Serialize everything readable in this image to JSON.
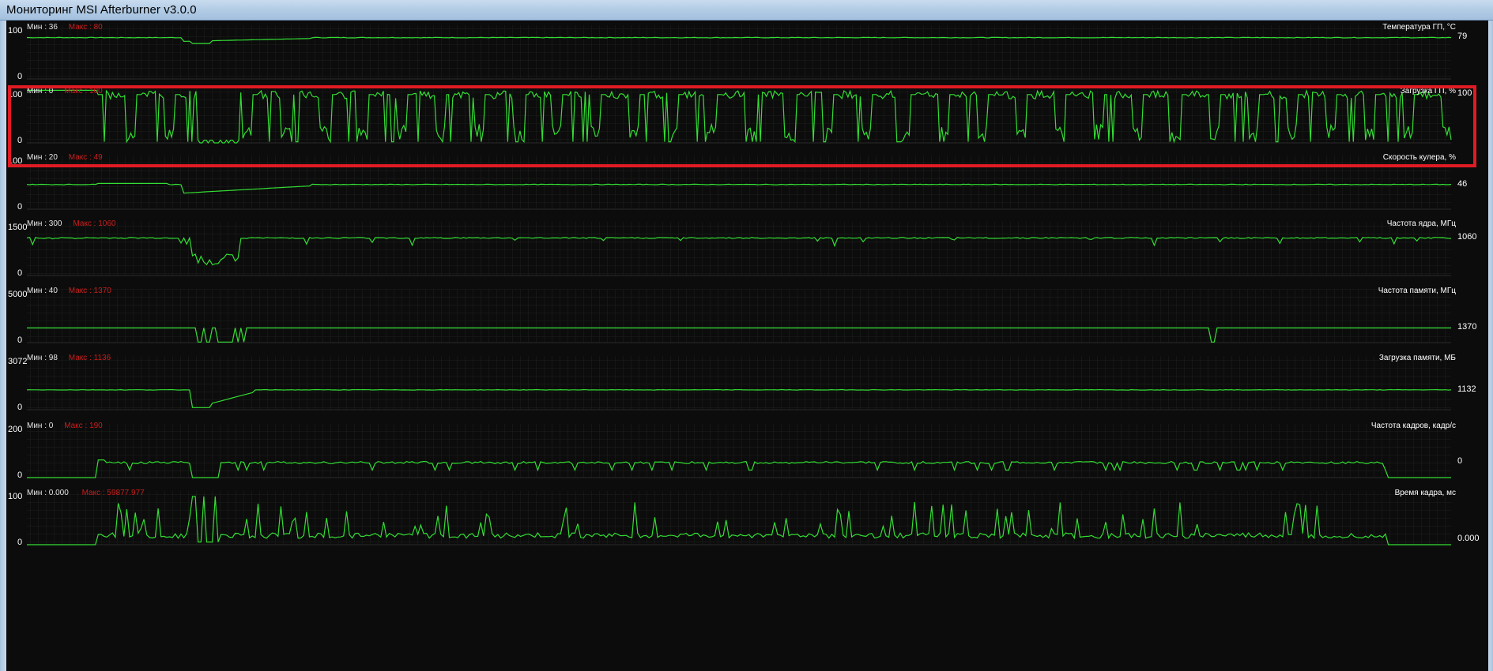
{
  "window": {
    "title": "Мониторинг MSI Afterburner v3.0.0"
  },
  "colors": {
    "graph_line": "#33dd33",
    "min_text": "#e6e6e6",
    "max_text": "#c81e1e",
    "highlight": "#e01b24"
  },
  "panels": [
    {
      "id": "gpu-temp",
      "name": "Температура ГП, °C",
      "min_label": "Мин : 36",
      "max_label": "Макс : 80",
      "axis_top": "100",
      "axis_bottom": "0",
      "current": "79",
      "level": 0.78,
      "pattern": "temp"
    },
    {
      "id": "gpu-load",
      "name": "Загрузка ГП, %",
      "min_label": "Мин : 0",
      "max_label": "Макс : 100",
      "axis_top": "100",
      "axis_bottom": "0",
      "current": "100",
      "level": 1.0,
      "pattern": "load"
    },
    {
      "id": "fan-speed",
      "name": "Скорость кулера, %",
      "min_label": "Мин : 20",
      "max_label": "Макс : 49",
      "axis_top": "100",
      "axis_bottom": "0",
      "current": "46",
      "level": 0.46,
      "pattern": "fan"
    },
    {
      "id": "core-clock",
      "name": "Частота ядра, МГц",
      "min_label": "Мин : 300",
      "max_label": "Макс : 1060",
      "axis_top": "1500",
      "axis_bottom": "0",
      "current": "1060",
      "level": 0.707,
      "pattern": "core"
    },
    {
      "id": "mem-clock",
      "name": "Частота памяти, МГц",
      "min_label": "Мин : 40",
      "max_label": "Макс : 1370",
      "axis_top": "5000",
      "axis_bottom": "0",
      "current": "1370",
      "level": 0.274,
      "pattern": "mem"
    },
    {
      "id": "mem-usage",
      "name": "Загрузка памяти, МБ",
      "min_label": "Мин : 98",
      "max_label": "Макс : 1136",
      "axis_top": "3072",
      "axis_bottom": "0",
      "current": "1132",
      "level": 0.368,
      "pattern": "memuse"
    },
    {
      "id": "framerate",
      "name": "Частота кадров, кадр/с",
      "min_label": "Мин : 0",
      "max_label": "Макс : 190",
      "axis_top": "200",
      "axis_bottom": "0",
      "current": "0",
      "level": 0.3,
      "pattern": "fps"
    },
    {
      "id": "frametime",
      "name": "Время кадра, мс",
      "min_label": "Мин : 0.000",
      "max_label": "Макс : 59877.977",
      "axis_top": "100",
      "axis_bottom": "0",
      "current": "0.000",
      "level": 0.1,
      "pattern": "frametime"
    }
  ]
}
